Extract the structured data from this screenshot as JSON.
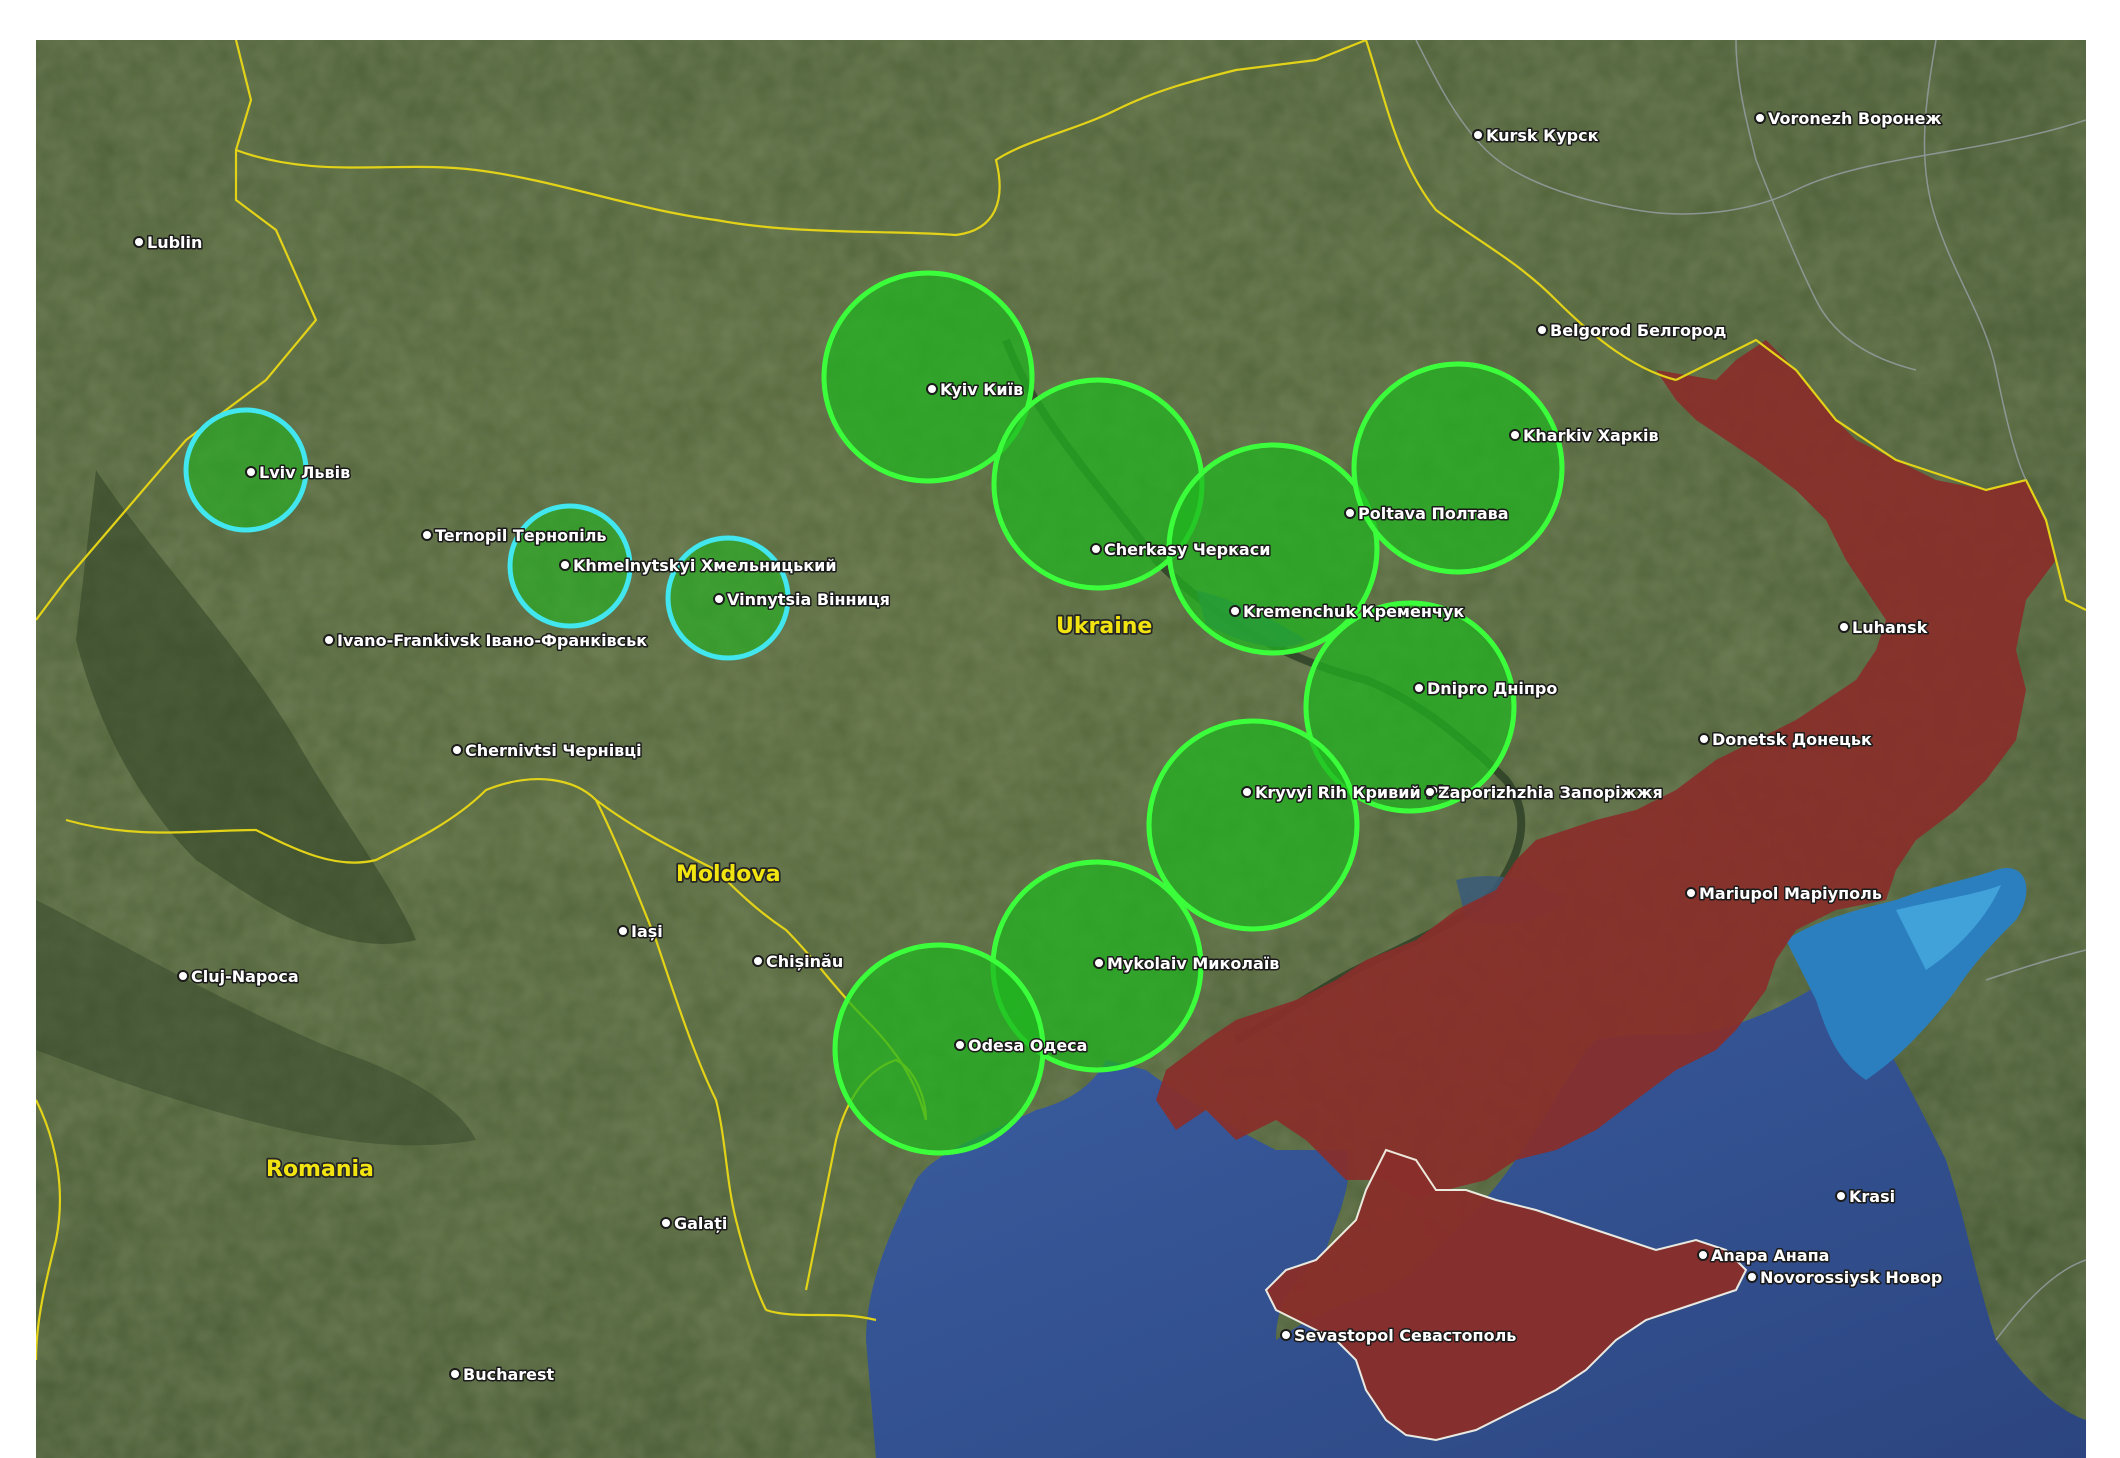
{
  "map": {
    "colors": {
      "land": "#4a5d35",
      "land_dark": "#3a4d2b",
      "sea": "#33508f",
      "sea_light": "#2f90c8",
      "border": "#e3d318",
      "occupied_fill": "#8a2e2a",
      "green_circle_fill": "#1fb51f",
      "green_circle_stroke": "#3cff3c",
      "cyan_circle_stroke": "#41e6ee"
    },
    "countries": [
      {
        "key": "ukraine",
        "name": "Ukraine"
      },
      {
        "key": "moldova",
        "name": "Moldova"
      },
      {
        "key": "romania",
        "name": "Romania"
      }
    ],
    "cities": [
      {
        "key": "lublin",
        "name": "Lublin"
      },
      {
        "key": "lviv",
        "name": "Lviv Львів"
      },
      {
        "key": "ternopil",
        "name": "Ternopil Тернопіль"
      },
      {
        "key": "khmelnytskyi",
        "name": "Khmelnytskyi Хмельницький"
      },
      {
        "key": "vinnytsia",
        "name": "Vinnytsia Вінниця"
      },
      {
        "key": "ivano-frankivsk",
        "name": "Ivano-Frankivsk Івано-Франківськ"
      },
      {
        "key": "chernivtsi",
        "name": "Chernivtsi Чернівці"
      },
      {
        "key": "iasi",
        "name": "Iași"
      },
      {
        "key": "chisinau",
        "name": "Chișinău"
      },
      {
        "key": "cluj-napoca",
        "name": "Cluj-Napoca"
      },
      {
        "key": "galati",
        "name": "Galați"
      },
      {
        "key": "bucharest",
        "name": "Bucharest"
      },
      {
        "key": "kyiv",
        "name": "Kyiv Київ"
      },
      {
        "key": "cherkasy",
        "name": "Cherkasy Черкаси"
      },
      {
        "key": "kremenchuk",
        "name": "Kremenchuk Кременчук"
      },
      {
        "key": "poltava",
        "name": "Poltava Полтава"
      },
      {
        "key": "kharkiv",
        "name": "Kharkiv Харків"
      },
      {
        "key": "dnipro",
        "name": "Dnipro Дніпро"
      },
      {
        "key": "kryvyi-rih",
        "name": "Kryvyi Rih Кривий Ріг"
      },
      {
        "key": "zaporizhzhia",
        "name": "Zaporizhzhia Запоріжжя"
      },
      {
        "key": "mykolaiv",
        "name": "Mykolaiv Миколаїв"
      },
      {
        "key": "odesa",
        "name": "Odesa Одеса"
      },
      {
        "key": "kursk",
        "name": "Kursk Курск"
      },
      {
        "key": "voronezh",
        "name": "Voronezh Воронеж"
      },
      {
        "key": "belgorod",
        "name": "Belgorod Белгород"
      },
      {
        "key": "luhansk",
        "name": "Luhansk"
      },
      {
        "key": "donetsk",
        "name": "Donetsk Донецьк"
      },
      {
        "key": "mariupol",
        "name": "Mariupol Маріуполь"
      },
      {
        "key": "anapa",
        "name": "Anapa Анапа"
      },
      {
        "key": "novorossiysk",
        "name": "Novorossiysk Новор"
      },
      {
        "key": "krasnodar",
        "name": "Krasi"
      },
      {
        "key": "sevastopol",
        "name": "Sevastopol Севастополь"
      }
    ],
    "coverage_circles": [
      {
        "key": "lviv",
        "style": "cyan"
      },
      {
        "key": "khmelnytskyi",
        "style": "cyan"
      },
      {
        "key": "vinnytsia",
        "style": "cyan"
      },
      {
        "key": "kyiv",
        "style": "green"
      },
      {
        "key": "cherkasy",
        "style": "green"
      },
      {
        "key": "kremenchuk",
        "style": "green"
      },
      {
        "key": "kharkiv",
        "style": "green"
      },
      {
        "key": "dnipro",
        "style": "green"
      },
      {
        "key": "kryvyi-rih",
        "style": "green"
      },
      {
        "key": "mykolaiv",
        "style": "green"
      },
      {
        "key": "odesa",
        "style": "green"
      }
    ]
  }
}
